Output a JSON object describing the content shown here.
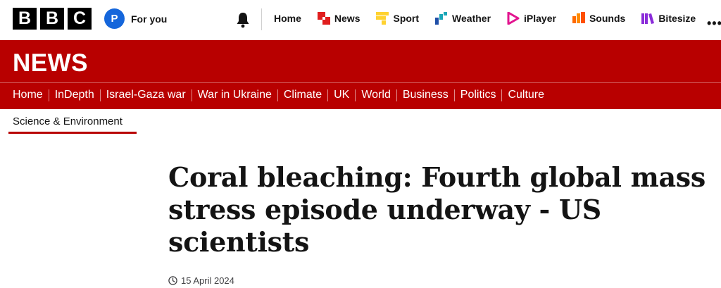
{
  "brand": {
    "logo_letters": [
      "B",
      "B",
      "C"
    ]
  },
  "account": {
    "avatar_initial": "P",
    "label": "For you"
  },
  "topnav": {
    "items": [
      {
        "label": "Home",
        "icon": "none"
      },
      {
        "label": "News",
        "icon": "news-icon",
        "color": "#e01e1e"
      },
      {
        "label": "Sport",
        "icon": "sport-icon",
        "color": "#ffd230"
      },
      {
        "label": "Weather",
        "icon": "weather-icon",
        "color": "#1aa6b7"
      },
      {
        "label": "iPlayer",
        "icon": "iplayer-icon",
        "color": "#e2148f"
      },
      {
        "label": "Sounds",
        "icon": "sounds-icon",
        "color": "#ff6a00"
      },
      {
        "label": "Bitesize",
        "icon": "bitesize-icon",
        "color": "#8a2bd9"
      }
    ],
    "more_label": "•••"
  },
  "news": {
    "wordmark": "NEWS",
    "sections": [
      "Home",
      "InDepth",
      "Israel-Gaza war",
      "War in Ukraine",
      "Climate",
      "UK",
      "World",
      "Business",
      "Politics",
      "Culture"
    ],
    "brand_color": "#b80000"
  },
  "subnav": {
    "active": "Science & Environment"
  },
  "article": {
    "headline": "Coral bleaching: Fourth global mass stress episode underway - US scientists",
    "date": "15 April 2024"
  }
}
